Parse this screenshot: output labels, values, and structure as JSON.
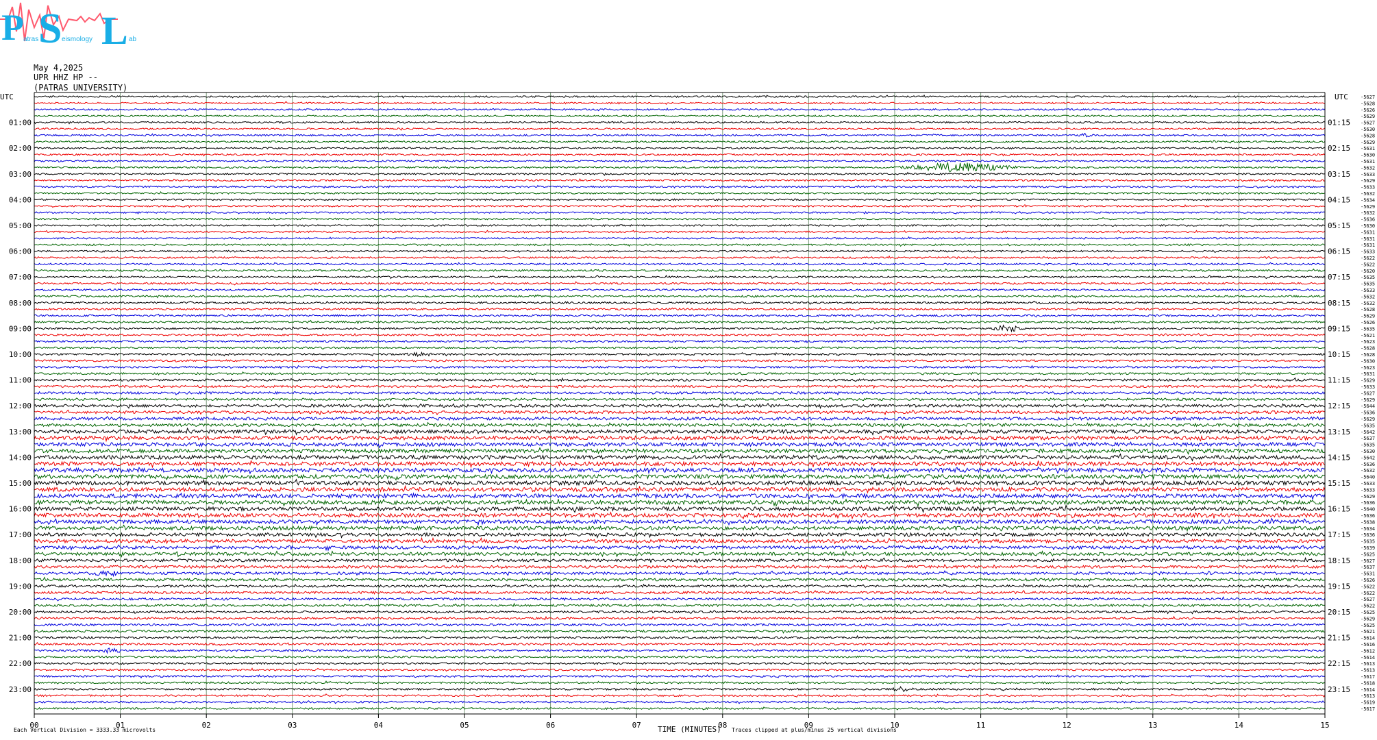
{
  "logo": {
    "letters": [
      "P",
      "S",
      "L"
    ],
    "words": [
      "atras",
      "eismology",
      "ab"
    ]
  },
  "header": {
    "date": "May 4,2025",
    "station": "UPR HHZ HP --",
    "org": "(PATRAS UNIVERSITY)"
  },
  "chart_data": {
    "type": "line",
    "title": "",
    "left_axis_title": "UTC",
    "right_axis_title": "UTC",
    "left_hour_labels": [
      "01:00",
      "02:00",
      "03:00",
      "04:00",
      "05:00",
      "06:00",
      "07:00",
      "08:00",
      "09:00",
      "10:00",
      "11:00",
      "12:00",
      "13:00",
      "14:00",
      "15:00",
      "16:00",
      "17:00",
      "18:00",
      "19:00",
      "20:00",
      "21:00",
      "22:00",
      "23:00"
    ],
    "right_hour_labels": [
      "01:15",
      "02:15",
      "03:15",
      "04:15",
      "05:15",
      "06:15",
      "07:15",
      "08:15",
      "09:15",
      "10:15",
      "11:15",
      "12:15",
      "13:15",
      "14:15",
      "15:15",
      "16:15",
      "17:15",
      "18:15",
      "19:15",
      "20:15",
      "21:15",
      "22:15",
      "23:15"
    ],
    "x_tick_labels": [
      "00",
      "01",
      "02",
      "03",
      "04",
      "05",
      "06",
      "07",
      "08",
      "09",
      "10",
      "11",
      "12",
      "13",
      "14",
      "15"
    ],
    "xlabel": "TIME (MINUTES)",
    "xlim": [
      0,
      15
    ],
    "trace_minutes": 15,
    "traces_per_hour": 4,
    "n_traces": 96,
    "trace_color_cycle": [
      "#000000",
      "#ee0000",
      "#0000dd",
      "#006400"
    ],
    "trace_offsets": [
      "-5627",
      "-5628",
      "-5626",
      "-5629",
      "-5627",
      "-5630",
      "-5628",
      "-5629",
      "-5631",
      "-5630",
      "-5631",
      "-5632",
      "-5633",
      "-5629",
      "-5633",
      "-5632",
      "-5634",
      "-5629",
      "-5632",
      "-5636",
      "-5630",
      "-5631",
      "-5631",
      "-5631",
      "-5633",
      "-5622",
      "-5622",
      "-5620",
      "-5635",
      "-5635",
      "-5633",
      "-5632",
      "-5632",
      "-5628",
      "-5629",
      "-5626",
      "-5635",
      "-5621",
      "-5623",
      "-5628",
      "-5628",
      "-5630",
      "-5623",
      "-5631",
      "-5629",
      "-5633",
      "-5627",
      "-5629",
      "-5644",
      "-5636",
      "-5629",
      "-5635",
      "-5642",
      "-5637",
      "-5635",
      "-5630",
      "-5642",
      "-5636",
      "-5632",
      "-5640",
      "-5633",
      "-5633",
      "-5629",
      "-5636",
      "-5640",
      "-5636",
      "-5638",
      "-5634",
      "-5636",
      "-5635",
      "-5639",
      "-5625",
      "-5627",
      "-5637",
      "-5631",
      "-5626",
      "-5622",
      "-5622",
      "-5627",
      "-5622",
      "-5625",
      "-5629",
      "-5625",
      "-5621",
      "-5614",
      "-5616",
      "-5612",
      "-5614",
      "-5613",
      "-5613",
      "-5617",
      "-5618",
      "-5614",
      "-5613",
      "-5619",
      "-5617"
    ],
    "ylim": [
      -25,
      25
    ],
    "units_per_division": 3333.33,
    "notes": {
      "scale": "Each Vertical Division = 3333.33 microvolts",
      "clip": "Traces clipped at plus/minus 25 vertical divisions"
    },
    "events": [
      {
        "trace": 11,
        "start_min": 10.0,
        "end_min": 11.5,
        "peak_min": 10.75,
        "amplitude": 7
      },
      {
        "trace": 6,
        "start_min": 12.1,
        "end_min": 12.35,
        "peak_min": 12.2,
        "amplitude": 2
      },
      {
        "trace": 36,
        "start_min": 11.15,
        "end_min": 11.5,
        "peak_min": 11.3,
        "amplitude": 5
      },
      {
        "trace": 40,
        "start_min": 4.3,
        "end_min": 4.7,
        "peak_min": 4.5,
        "amplitude": 2.5
      },
      {
        "trace": 92,
        "start_min": 9.95,
        "end_min": 10.25,
        "peak_min": 10.1,
        "amplitude": 3
      },
      {
        "trace": 86,
        "start_min": 0.7,
        "end_min": 1.0,
        "peak_min": 0.9,
        "amplitude": 3
      },
      {
        "trace": 74,
        "start_min": 0.6,
        "end_min": 1.0,
        "peak_min": 0.85,
        "amplitude": 3
      }
    ],
    "noise_profile": [
      1.2,
      1.2,
      1.2,
      1.2,
      1.2,
      1.2,
      1.2,
      1.2,
      1.2,
      1.2,
      1.2,
      1.2,
      1.2,
      1.2,
      1.2,
      1.2,
      1.2,
      1.2,
      1.2,
      1.2,
      1.2,
      1.2,
      1.2,
      1.2,
      1.3,
      1.3,
      1.3,
      1.3,
      1.3,
      1.3,
      1.3,
      1.3,
      1.3,
      1.3,
      1.3,
      1.3,
      1.3,
      1.3,
      1.3,
      1.3,
      1.4,
      1.4,
      1.4,
      1.4,
      1.6,
      1.6,
      1.7,
      1.7,
      2.0,
      2.0,
      2.1,
      2.1,
      2.6,
      2.6,
      2.7,
      2.7,
      2.8,
      2.8,
      2.9,
      2.9,
      2.9,
      2.9,
      2.9,
      2.9,
      2.8,
      2.8,
      2.7,
      2.7,
      2.4,
      2.4,
      2.3,
      2.3,
      2.0,
      2.0,
      1.9,
      1.9,
      1.7,
      1.7,
      1.6,
      1.6,
      1.5,
      1.5,
      1.5,
      1.5,
      1.4,
      1.4,
      1.4,
      1.4,
      1.3,
      1.3,
      1.3,
      1.3,
      1.3,
      1.3,
      1.3,
      1.3
    ]
  }
}
